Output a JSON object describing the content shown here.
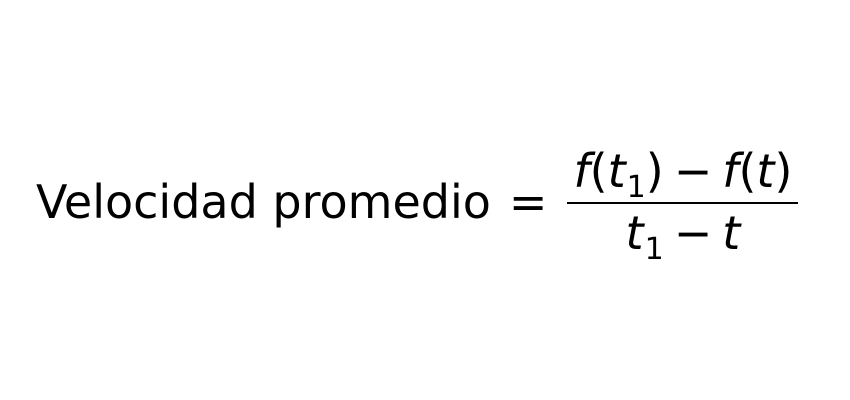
{
  "equation": {
    "lhs": "Velocidad promedio",
    "equals": "=",
    "numerator": {
      "f1": "f",
      "open1": "(",
      "t1": "t",
      "t1_sub": "1",
      "close1": ")",
      "minus": "−",
      "f2": "f",
      "open2": "(",
      "t2": "t",
      "close2": ")"
    },
    "denominator": {
      "t1": "t",
      "t1_sub": "1",
      "minus": "−",
      "t2": "t"
    }
  }
}
